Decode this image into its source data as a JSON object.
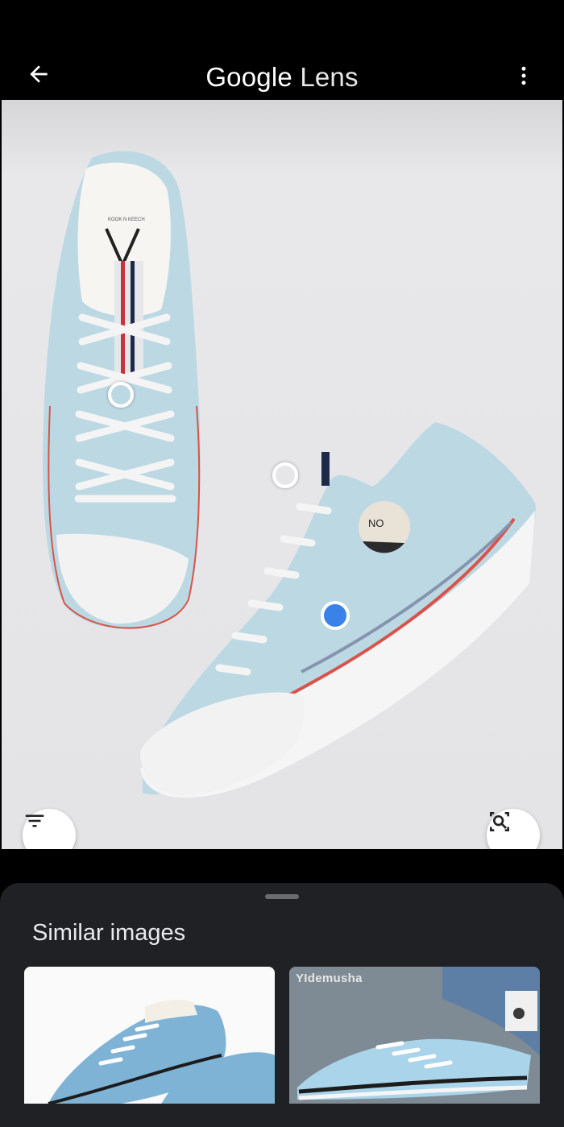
{
  "appbar": {
    "title_brand": "Google",
    "title_product": "Lens",
    "back_icon": "arrow-back-icon",
    "menu_icon": "more-vert-icon"
  },
  "viewer": {
    "filter_icon": "filter-list-icon",
    "search_region_icon": "search-region-icon"
  },
  "sheet": {
    "title": "Similar images",
    "results": [
      {
        "source": ""
      },
      {
        "source": "YIdemusha"
      }
    ]
  },
  "colors": {
    "accent": "#3b82e8",
    "sheet_bg": "#202124",
    "shoe_blue": "#bcd9e3"
  }
}
